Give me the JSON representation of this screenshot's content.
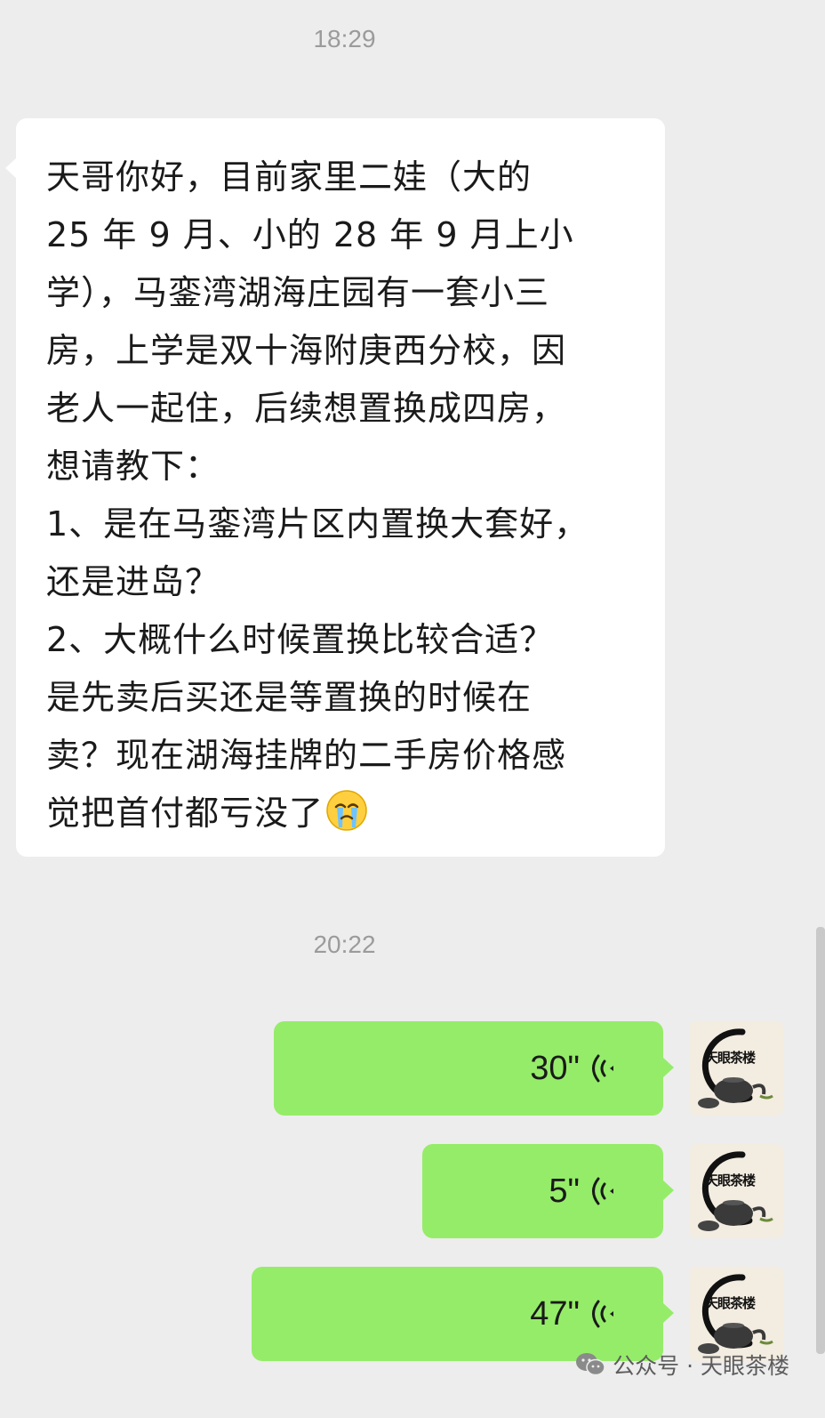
{
  "timestamps": [
    "18:29",
    "20:22"
  ],
  "incoming_message": {
    "lines": [
      "天哥你好，目前家里二娃（大的",
      "25 年 9 月、小的 28 年 9 月上小",
      "学），马銮湾湖海庄园有一套小三",
      "房，上学是双十海附庚西分校，因",
      "老人一起住，后续想置换成四房，",
      "想请教下：",
      "1、是在马銮湾片区内置换大套好，",
      "还是进岛？",
      "2、大概什么时候置换比较合适？",
      "是先卖后买还是等置换的时候在",
      "卖？现在湖海挂牌的二手房价格感",
      "觉把首付都亏没了"
    ],
    "emoji": "crying-face"
  },
  "voice_messages": [
    {
      "duration": "30\""
    },
    {
      "duration": "5\""
    },
    {
      "duration": "47\""
    }
  ],
  "avatar": {
    "label": "天眼茶楼"
  },
  "watermark": {
    "text": "公众号 · 天眼茶楼"
  },
  "colors": {
    "background": "#ededed",
    "incoming_bubble": "#ffffff",
    "outgoing_bubble": "#95ec69",
    "timestamp": "#9b9b9b"
  }
}
